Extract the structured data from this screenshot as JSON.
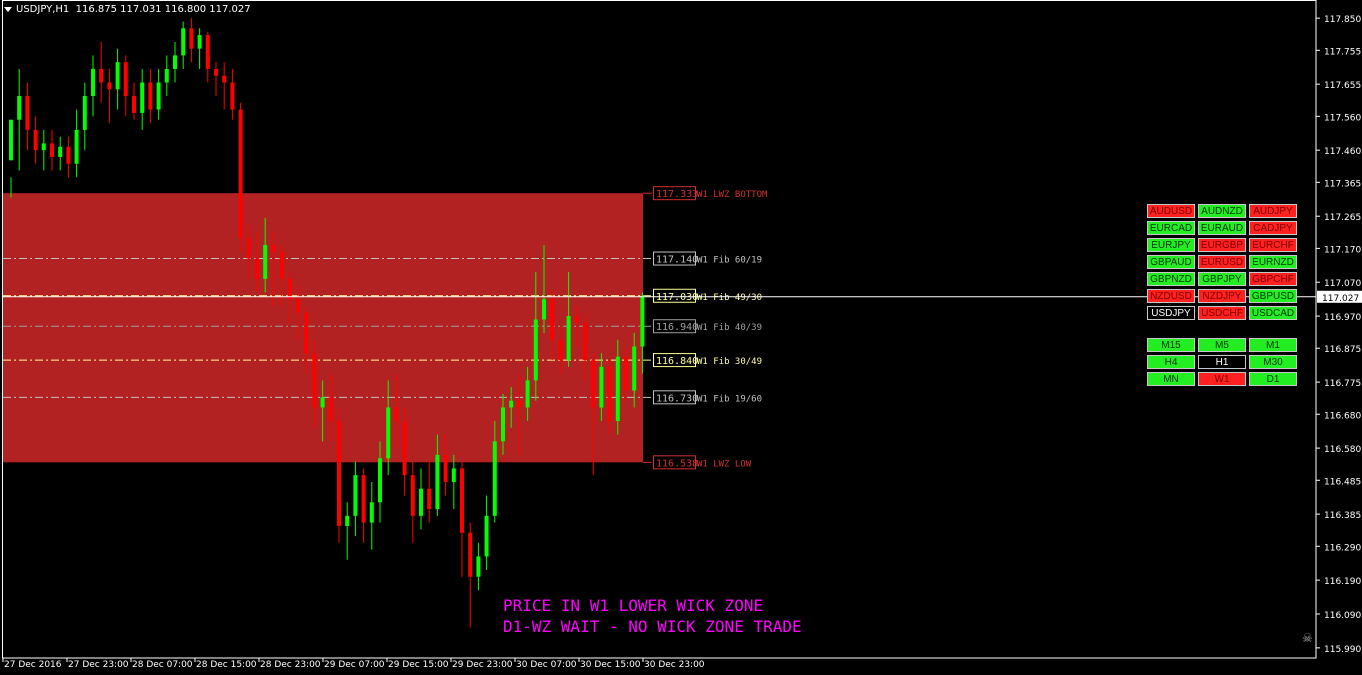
{
  "window": {
    "title": "USDJPY,H1  116.875 117.031 116.800 117.027"
  },
  "colors": {
    "bull": "#00ff00",
    "bear": "#ff0000",
    "zone": "#b22222",
    "axis": "#ffffff",
    "price_line": "#ffffff"
  },
  "price_axis": {
    "ticks": [
      "117.850",
      "117.755",
      "117.655",
      "117.560",
      "117.460",
      "117.365",
      "117.265",
      "117.170",
      "117.070",
      "116.970",
      "116.875",
      "116.775",
      "116.680",
      "116.580",
      "116.485",
      "116.385",
      "116.290",
      "116.190",
      "116.090",
      "115.990"
    ],
    "current_price": "117.027"
  },
  "time_axis": {
    "ticks": [
      "27 Dec 2016",
      "27 Dec 23:00",
      "28 Dec 07:00",
      "28 Dec 15:00",
      "28 Dec 23:00",
      "29 Dec 07:00",
      "29 Dec 15:00",
      "29 Dec 23:00",
      "30 Dec 07:00",
      "30 Dec 15:00",
      "30 Dec 23:00"
    ]
  },
  "levels": [
    {
      "price": "117.333",
      "label": "W1 LWZ BOTTOM",
      "color": "#d03030"
    },
    {
      "price": "117.140",
      "label": "W1 Fib 60/19",
      "color": "#c0c0c0"
    },
    {
      "price": "117.030",
      "label": "W1 Fib 49/30",
      "color": "#ffff99"
    },
    {
      "price": "116.940",
      "label": "W1 Fib 40/39",
      "color": "#a0a0a0"
    },
    {
      "price": "116.840",
      "label": "W1 Fib 30/49",
      "color": "#ffff99"
    },
    {
      "price": "116.730",
      "label": "W1 Fib 19/60",
      "color": "#c0c0c0"
    },
    {
      "price": "116.538",
      "label": "W1 LWZ LOW",
      "color": "#d03030"
    }
  ],
  "pairs": [
    {
      "label": "AUDUSD",
      "state": "red"
    },
    {
      "label": "AUDNZD",
      "state": "green"
    },
    {
      "label": "AUDJPY",
      "state": "red"
    },
    {
      "label": "EURCAD",
      "state": "green"
    },
    {
      "label": "EURAUD",
      "state": "green"
    },
    {
      "label": "CADJPY",
      "state": "red"
    },
    {
      "label": "EURJPY",
      "state": "green"
    },
    {
      "label": "EURGBP",
      "state": "red"
    },
    {
      "label": "EURCHF",
      "state": "red"
    },
    {
      "label": "GBPAUD",
      "state": "green"
    },
    {
      "label": "EURUSD",
      "state": "red"
    },
    {
      "label": "EURNZD",
      "state": "green"
    },
    {
      "label": "GBPNZD",
      "state": "green"
    },
    {
      "label": "GBPJPY",
      "state": "green"
    },
    {
      "label": "GBPCHF",
      "state": "red"
    },
    {
      "label": "NZDUSD",
      "state": "red"
    },
    {
      "label": "NZDJPY",
      "state": "red"
    },
    {
      "label": "GBPUSD",
      "state": "green"
    },
    {
      "label": "USDJPY",
      "state": "black"
    },
    {
      "label": "USDCHF",
      "state": "red"
    },
    {
      "label": "USDCAD",
      "state": "green"
    }
  ],
  "timeframes": [
    {
      "label": "M15",
      "state": "green"
    },
    {
      "label": "M5",
      "state": "green"
    },
    {
      "label": "M1",
      "state": "green"
    },
    {
      "label": "H4",
      "state": "green"
    },
    {
      "label": "H1",
      "state": "black"
    },
    {
      "label": "M30",
      "state": "green"
    },
    {
      "label": "MN",
      "state": "green"
    },
    {
      "label": "W1",
      "state": "red"
    },
    {
      "label": "D1",
      "state": "green"
    }
  ],
  "messages": {
    "line1": "PRICE IN W1 LOWER WICK ZONE",
    "line2": "D1-WZ WAIT - NO WICK ZONE TRADE"
  },
  "candles": [
    [
      117.43,
      117.55,
      117.38,
      117.32
    ],
    [
      117.55,
      117.62,
      117.7,
      117.4
    ],
    [
      117.62,
      117.52,
      117.66,
      117.46
    ],
    [
      117.52,
      117.46,
      117.56,
      117.42
    ],
    [
      117.46,
      117.48,
      117.52,
      117.4
    ],
    [
      117.48,
      117.44,
      117.52,
      117.4
    ],
    [
      117.44,
      117.47,
      117.5,
      117.4
    ],
    [
      117.47,
      117.42,
      117.5,
      117.38
    ],
    [
      117.42,
      117.52,
      117.58,
      117.38
    ],
    [
      117.52,
      117.62,
      117.66,
      117.46
    ],
    [
      117.62,
      117.7,
      117.74,
      117.56
    ],
    [
      117.7,
      117.66,
      117.78,
      117.6
    ],
    [
      117.66,
      117.64,
      117.7,
      117.54
    ],
    [
      117.64,
      117.72,
      117.76,
      117.58
    ],
    [
      117.72,
      117.62,
      117.74,
      117.56
    ],
    [
      117.62,
      117.57,
      117.66,
      117.55
    ],
    [
      117.57,
      117.66,
      117.7,
      117.52
    ],
    [
      117.66,
      117.58,
      117.7,
      117.54
    ],
    [
      117.58,
      117.66,
      117.7,
      117.55
    ],
    [
      117.66,
      117.7,
      117.74,
      117.62
    ],
    [
      117.7,
      117.74,
      117.78,
      117.66
    ],
    [
      117.74,
      117.82,
      117.84,
      117.7
    ],
    [
      117.82,
      117.76,
      117.85,
      117.72
    ],
    [
      117.76,
      117.8,
      117.82,
      117.7
    ],
    [
      117.8,
      117.7,
      117.81,
      117.66
    ],
    [
      117.7,
      117.68,
      117.72,
      117.62
    ],
    [
      117.68,
      117.66,
      117.72,
      117.58
    ],
    [
      117.66,
      117.58,
      117.7,
      117.55
    ],
    [
      117.58,
      117.2,
      117.6,
      117.16
    ],
    [
      117.2,
      117.14,
      117.24,
      117.08
    ],
    [
      117.14,
      117.08,
      117.22,
      117.04
    ],
    [
      117.08,
      117.18,
      117.26,
      117.04
    ],
    [
      117.18,
      117.16,
      117.22,
      117.0
    ],
    [
      117.16,
      117.08,
      117.18,
      117.0
    ],
    [
      117.08,
      117.02,
      117.1,
      116.95
    ],
    [
      117.02,
      116.98,
      117.06,
      116.9
    ],
    [
      116.98,
      116.86,
      117.0,
      116.8
    ],
    [
      116.86,
      116.7,
      116.9,
      116.64
    ],
    [
      116.7,
      116.73,
      116.78,
      116.6
    ],
    [
      116.73,
      116.66,
      116.8,
      116.6
    ],
    [
      116.66,
      116.35,
      116.7,
      116.3
    ],
    [
      116.35,
      116.38,
      116.42,
      116.25
    ],
    [
      116.38,
      116.5,
      116.54,
      116.32
    ],
    [
      116.5,
      116.36,
      116.52,
      116.3
    ],
    [
      116.36,
      116.42,
      116.48,
      116.28
    ],
    [
      116.42,
      116.55,
      116.6,
      116.36
    ],
    [
      116.55,
      116.7,
      116.78,
      116.5
    ],
    [
      116.7,
      116.66,
      116.8,
      116.58
    ],
    [
      116.66,
      116.5,
      116.7,
      116.44
    ],
    [
      116.5,
      116.38,
      116.54,
      116.3
    ],
    [
      116.38,
      116.46,
      116.52,
      116.34
    ],
    [
      116.46,
      116.4,
      116.54,
      116.36
    ],
    [
      116.4,
      116.56,
      116.62,
      116.38
    ],
    [
      116.56,
      116.48,
      116.62,
      116.44
    ],
    [
      116.48,
      116.52,
      116.56,
      116.4
    ],
    [
      116.52,
      116.33,
      116.54,
      116.2
    ],
    [
      116.33,
      116.2,
      116.36,
      116.05
    ],
    [
      116.2,
      116.26,
      116.3,
      116.16
    ],
    [
      116.26,
      116.38,
      116.44,
      116.22
    ],
    [
      116.38,
      116.6,
      116.66,
      116.36
    ],
    [
      116.6,
      116.7,
      116.74,
      116.56
    ],
    [
      116.7,
      116.72,
      116.76,
      116.64
    ],
    [
      116.72,
      116.7,
      116.8,
      116.56
    ],
    [
      116.7,
      116.78,
      116.82,
      116.66
    ],
    [
      116.78,
      116.96,
      117.1,
      116.72
    ],
    [
      116.96,
      117.02,
      117.18,
      116.92
    ],
    [
      117.02,
      116.9,
      117.05,
      116.84
    ],
    [
      116.9,
      116.84,
      116.94,
      116.8
    ],
    [
      116.84,
      116.97,
      117.1,
      116.82
    ],
    [
      116.97,
      116.95,
      117.0,
      116.88
    ],
    [
      116.95,
      116.84,
      116.98,
      116.78
    ],
    [
      116.84,
      116.7,
      116.86,
      116.5
    ],
    [
      116.7,
      116.82,
      116.86,
      116.66
    ],
    [
      116.82,
      116.66,
      116.84,
      116.62
    ],
    [
      116.66,
      116.85,
      116.9,
      116.62
    ],
    [
      116.85,
      116.75,
      116.88,
      116.72
    ],
    [
      116.75,
      116.88,
      116.92,
      116.7
    ],
    [
      116.88,
      117.03,
      117.04,
      116.8
    ]
  ]
}
